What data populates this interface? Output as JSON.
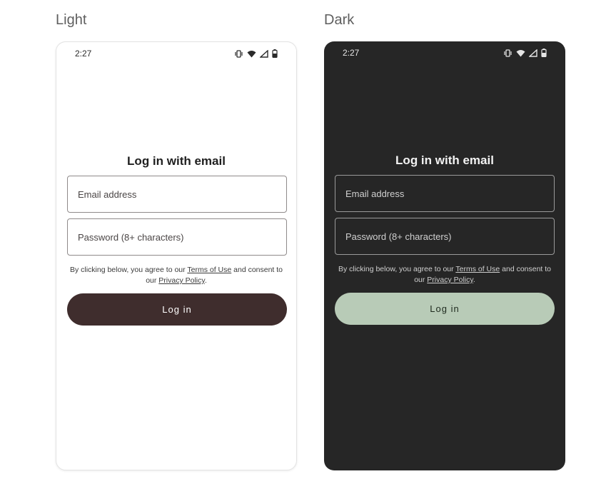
{
  "labels": {
    "light": "Light",
    "dark": "Dark"
  },
  "status_bar": {
    "time": "2:27",
    "icons": [
      "vibrate-icon",
      "wifi-icon",
      "cell-signal-icon",
      "battery-icon"
    ]
  },
  "form": {
    "title": "Log in with email",
    "email_placeholder": "Email address",
    "password_placeholder": "Password (8+ characters)",
    "terms_prefix": "By clicking below, you agree to our ",
    "terms_link": "Terms of Use",
    "terms_middle": " and consent to our ",
    "privacy_link": "Privacy Policy",
    "terms_suffix": ".",
    "login_label": "Log in"
  },
  "colors": {
    "light_button": "#3f2d2d",
    "dark_background": "#262626",
    "dark_button": "#b8cbb7"
  }
}
